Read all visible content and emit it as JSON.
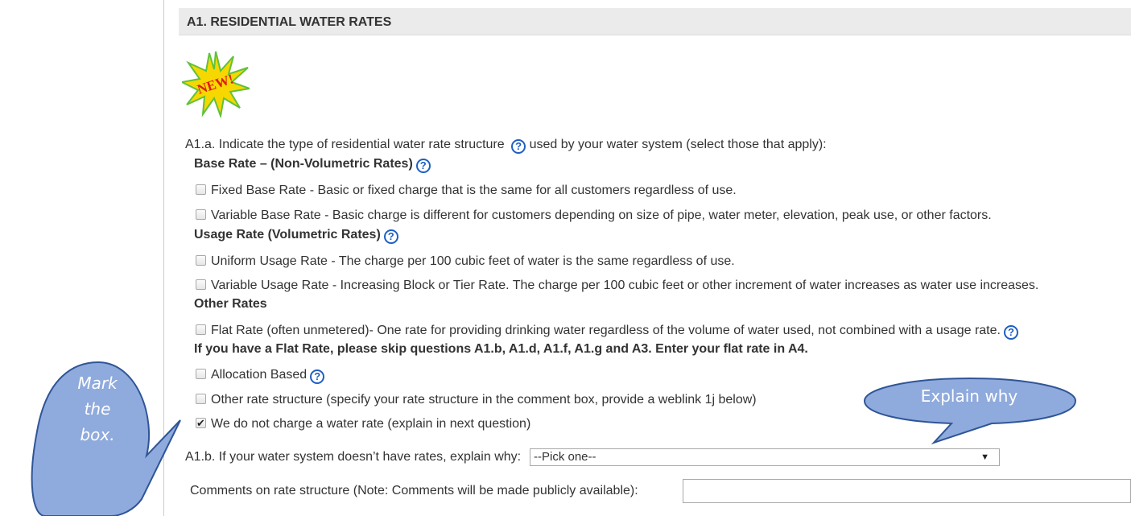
{
  "section": {
    "title": "A1. RESIDENTIAL WATER RATES",
    "badge_text": "NEW!"
  },
  "question_a": {
    "text": "A1.a. Indicate the type of residential water rate structure",
    "text_after_help": "used by your water system (select those that apply):",
    "groups": [
      {
        "heading": "Base Rate – (Non-Volumetric Rates)",
        "options": [
          {
            "label": "Fixed Base Rate - Basic or fixed charge that is the same for all customers regardless of use.",
            "checked": false
          },
          {
            "label": "Variable Base Rate - Basic charge is different for customers depending on size of pipe, water meter, elevation, peak use, or other factors.",
            "checked": false
          }
        ]
      },
      {
        "heading": "Usage Rate (Volumetric Rates)",
        "options": [
          {
            "label": "Uniform Usage Rate - The charge per 100 cubic feet of water is the same regardless of use.",
            "checked": false
          },
          {
            "label": "Variable Usage Rate - Increasing Block or Tier Rate. The charge per 100 cubic feet or other increment of water increases as water use increases.",
            "checked": false
          }
        ]
      },
      {
        "heading": "Other Rates",
        "options": [
          {
            "label": "Flat Rate (often unmetered)- One rate for providing drinking water regardless of the volume of water used, not combined with a usage rate.",
            "checked": false
          }
        ],
        "note": "If you have a Flat Rate, please skip questions A1.b, A1.d, A1.f, A1.g and A3. Enter your flat rate in A4."
      }
    ],
    "extra_options": [
      {
        "label": "Allocation Based",
        "checked": false
      },
      {
        "label": "Other rate structure (specify your rate structure in the comment box, provide a weblink 1j below)",
        "checked": false
      },
      {
        "label": "We do not charge a water rate (explain in next question)",
        "checked": true
      }
    ]
  },
  "question_b": {
    "text": "A1.b. If your water system doesn’t have rates, explain why:",
    "select_value": "--Pick one--"
  },
  "comments": {
    "label": "Comments on rate structure (Note: Comments will be made publicly available):",
    "value": ""
  },
  "callouts": {
    "left": [
      "Mark",
      "the",
      "box."
    ],
    "right": "Explain why",
    "fill_color": "#8faadc",
    "stroke_color": "#2f5597"
  },
  "colors": {
    "help_icon": "#1e5fc4",
    "header_bg": "#ebebeb"
  }
}
